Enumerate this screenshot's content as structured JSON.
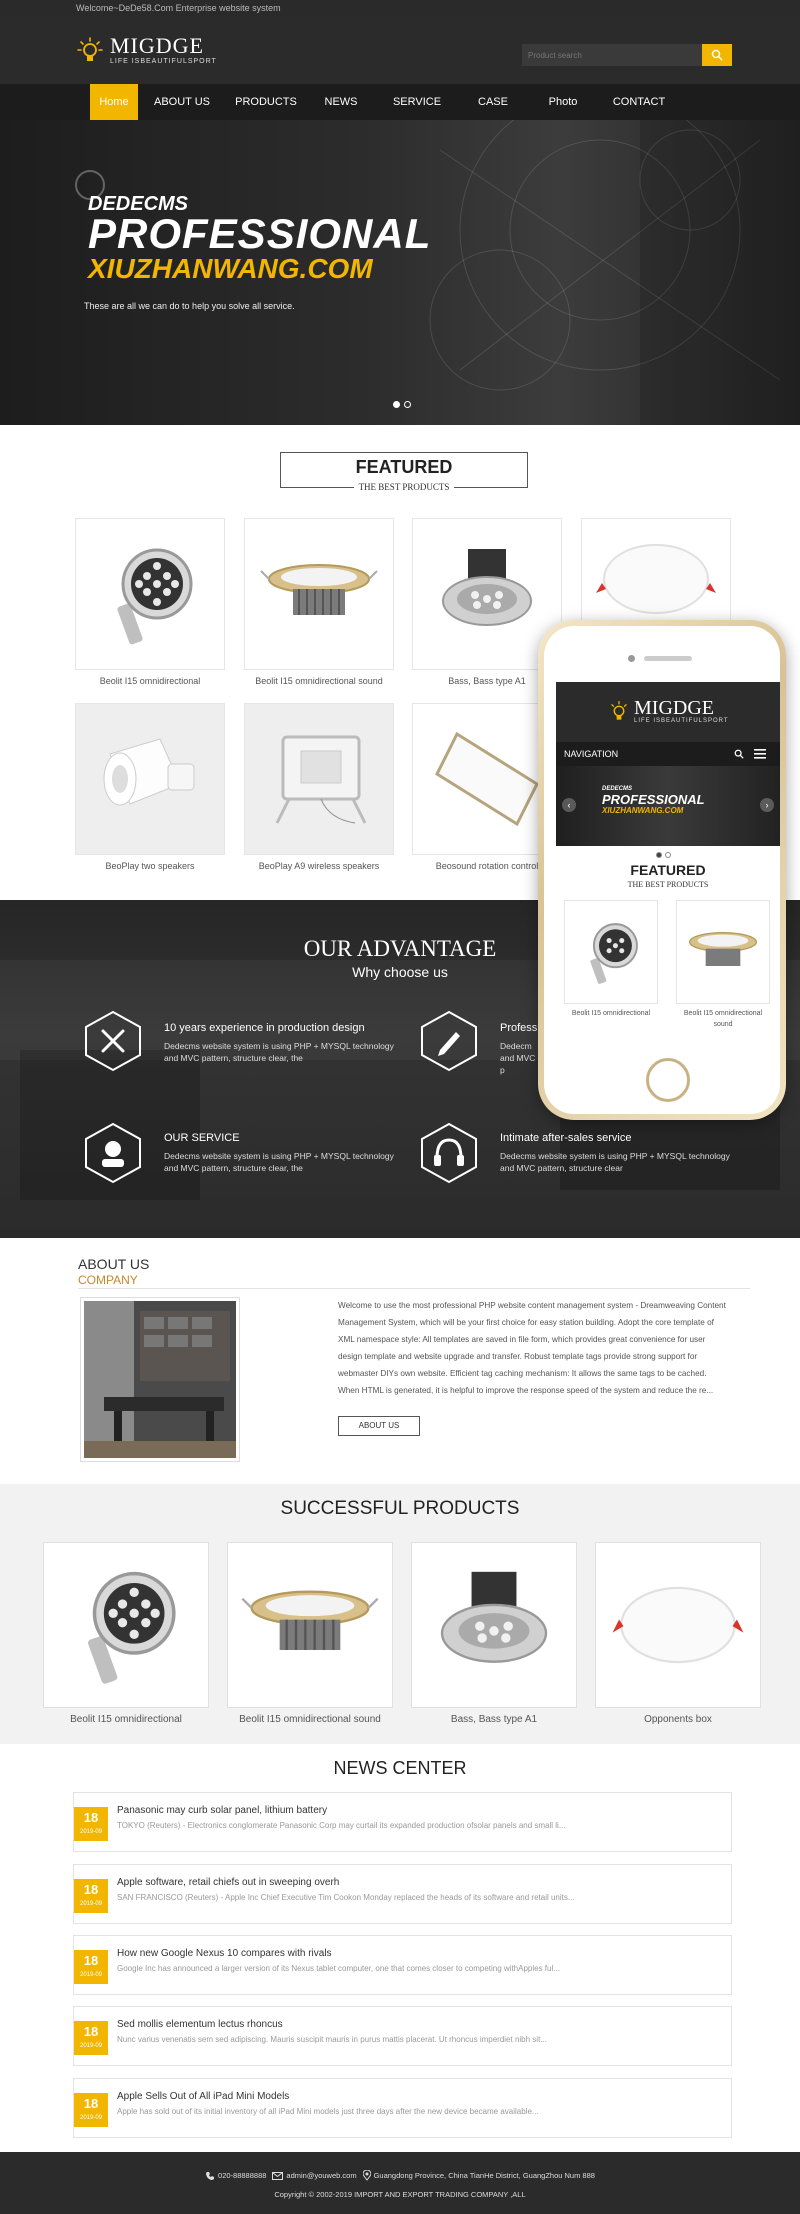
{
  "topbar": {
    "text": "Welcome~DeDe58.Com Enterprise website system"
  },
  "logo": {
    "name": "MIGDGE",
    "tagline": "LIFE ISBEAUTIFULSPORT"
  },
  "search": {
    "placeholder": "Product search"
  },
  "nav": {
    "items": [
      "Home",
      "ABOUT US",
      "PRODUCTS",
      "NEWS",
      "SERVICE",
      "CASE",
      "Photo",
      "CONTACT"
    ],
    "active": "Home"
  },
  "banner": {
    "line1": "DEDECMS",
    "line2": "PROFESSIONAL",
    "line3": "XIUZHANWANG.COM",
    "desc": "These are all we can do to help you solve all service."
  },
  "featured": {
    "title": "FEATURED",
    "subtitle": "THE BEST PRODUCTS",
    "items": [
      "Beolit I15 omnidirectional",
      "Beolit I15 omnidirectional sound",
      "Bass, Bass type A1",
      "",
      "BeoPlay two speakers",
      "BeoPlay A9 wireless speakers",
      "Beosound rotation control",
      ""
    ]
  },
  "phone": {
    "logo": "MIGDGE",
    "tagline": "LIFE ISBEAUTIFULSPORT",
    "nav_label": "NAVIGATION",
    "banner_line1": "DEDECMS",
    "banner_line2": "PROFESSIONAL",
    "banner_line3": "XIUZHANWANG.COM",
    "featured_title": "FEATURED",
    "featured_sub": "THE BEST PRODUCTS",
    "items": [
      "Beolit I15 omnidirectional",
      "Beolit I15 omnidirectional sound"
    ]
  },
  "advantage": {
    "title": "OUR ADVANTAGE",
    "subtitle": "Why choose us",
    "items": [
      {
        "title": "10 years experience in production design",
        "text": "Dedecms website system is using PHP + MYSQL technology and MVC pattern, structure clear, the",
        "icon": "tools-icon"
      },
      {
        "title": "Professi",
        "text": "Dedecm and MVC p",
        "icon": "pen-icon"
      },
      {
        "title": "OUR SERVICE",
        "text": "Dedecms website system is using PHP + MYSQL technology and MVC pattern, structure clear, the",
        "icon": "support-icon"
      },
      {
        "title": "Intimate after-sales service",
        "text": "Dedecms website system is using PHP + MYSQL technology and MVC pattern, structure clear",
        "icon": "headphones-icon"
      }
    ]
  },
  "about": {
    "title": "ABOUT US",
    "subtitle": "COMPANY",
    "text": "Welcome to use the most professional PHP website content management system - Dreamweaving Content Management System, which will be your first choice for easy station building. Adopt the core template of XML namespace style: All templates are saved in file form, which provides great convenience for user design template and website upgrade and transfer. Robust template tags provide strong support for webmaster DIYs own website. Efficient tag caching mechanism: It allows the same tags to be cached. When HTML is generated, it is helpful to improve the response speed of the system and reduce the re...",
    "button": "ABOUT US"
  },
  "successful": {
    "title": "SUCCESSFUL PRODUCTS",
    "items": [
      "Beolit I15 omnidirectional",
      "Beolit I15 omnidirectional sound",
      "Bass, Bass type A1",
      "Opponents box"
    ]
  },
  "news": {
    "title": "NEWS CENTER",
    "items": [
      {
        "day": "18",
        "ym": "2019-09",
        "title": "Panasonic may curb solar panel, lithium battery",
        "desc": "TOKYO (Reuters) - Electronics conglomerate Panasonic Corp may curtail its expanded production ofsolar panels and small li..."
      },
      {
        "day": "18",
        "ym": "2019-09",
        "title": "Apple software, retail chiefs out in sweeping overh",
        "desc": "SAN FRANCISCO (Reuters) - Apple Inc Chief Executive Tim Cookon Monday replaced the heads of its software and retail units..."
      },
      {
        "day": "18",
        "ym": "2019-09",
        "title": "How new Google Nexus 10 compares with rivals",
        "desc": "Google Inc has announced a larger version of its Nexus tablet computer, one that comes closer to competing withApples ful..."
      },
      {
        "day": "18",
        "ym": "2019-09",
        "title": "Sed mollis elementum lectus rhoncus",
        "desc": "Nunc varius venenatis sem sed adipiscing. Mauris suscipit mauris in purus mattis placerat. Ut rhoncus imperdiet nibh sit..."
      },
      {
        "day": "18",
        "ym": "2019-09",
        "title": "Apple Sells Out of All iPad Mini Models",
        "desc": "Apple has sold out of its initial inventory of all iPad Mini models just three days after the new device became available..."
      }
    ]
  },
  "footer": {
    "phone": "020-88888888",
    "email": "admin@youweb.com",
    "address": "Guangdong Province, China TianHe District, GuangZhou Num 888",
    "copyright": "Copyright © 2002-2019 IMPORT AND EXPORT TRADING COMPANY ,ALL"
  },
  "colors": {
    "accent": "#f2b600",
    "dark": "#2b2b2b",
    "about_subtitle": "#c8882a"
  }
}
